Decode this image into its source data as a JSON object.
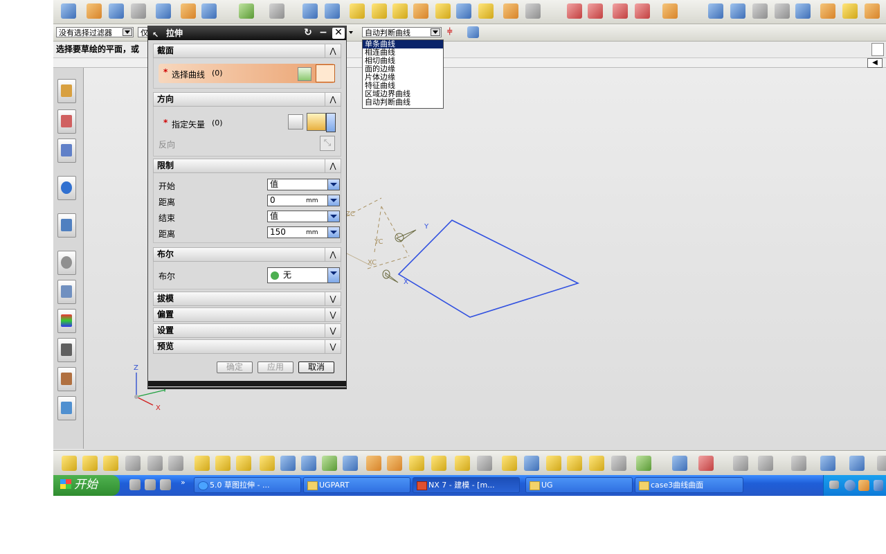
{
  "filter_bar": {
    "type_filter": "没有选择过滤器",
    "scope_filter": "仅",
    "curve_rule": "自动判断曲线"
  },
  "cue_line": "选择要草绘的平面，或",
  "curve_rule_menu": {
    "options": [
      "单条曲线",
      "相连曲线",
      "相切曲线",
      "面的边缘",
      "片体边缘",
      "特征曲线",
      "区域边界曲线",
      "自动判断曲线"
    ],
    "selected_index": 0
  },
  "dialog": {
    "title": "拉伸",
    "sections": {
      "section": {
        "header": "截面",
        "select_curve_label": "选择曲线",
        "select_curve_count": "(0)"
      },
      "direction": {
        "header": "方向",
        "vector_label": "指定矢量",
        "vector_count": "(0)",
        "reverse_label": "反向"
      },
      "limits": {
        "header": "限制",
        "start_label": "开始",
        "start_option": "值",
        "start_distance_label": "距离",
        "start_distance_value": "0",
        "end_label": "结束",
        "end_option": "值",
        "end_distance_label": "距离",
        "end_distance_value": "150",
        "unit": "mm"
      },
      "boolean": {
        "header": "布尔",
        "label": "布尔",
        "value": "无"
      },
      "draft": {
        "header": "拔模"
      },
      "offset": {
        "header": "偏置"
      },
      "settings": {
        "header": "设置"
      },
      "preview": {
        "header": "预览"
      }
    },
    "buttons": {
      "ok": "确定",
      "apply": "应用",
      "cancel": "取消"
    }
  },
  "viewport": {
    "wcs_labels": {
      "x": "X",
      "y": "Y",
      "xc": "XC",
      "yc": "YC",
      "zc": "ZC"
    },
    "triad_labels": {
      "x": "X",
      "y": "Y",
      "z": "Z"
    },
    "sketch_color": "#3050e0"
  },
  "taskbar": {
    "start_label": "开始",
    "items": [
      {
        "label": "5.0 草图拉伸 - ...",
        "active": false
      },
      {
        "label": "UGPART",
        "active": false
      },
      {
        "label": "NX 7 - 建模 - [m...",
        "active": true
      },
      {
        "label": "UG",
        "active": false
      },
      {
        "label": "case3曲线曲面",
        "active": false
      }
    ]
  },
  "colors": {
    "taskbar_blue": "#2458c8",
    "start_green": "#2f8c2f",
    "dialog_title": "#111111",
    "selection_highlight": "#f0b080"
  }
}
